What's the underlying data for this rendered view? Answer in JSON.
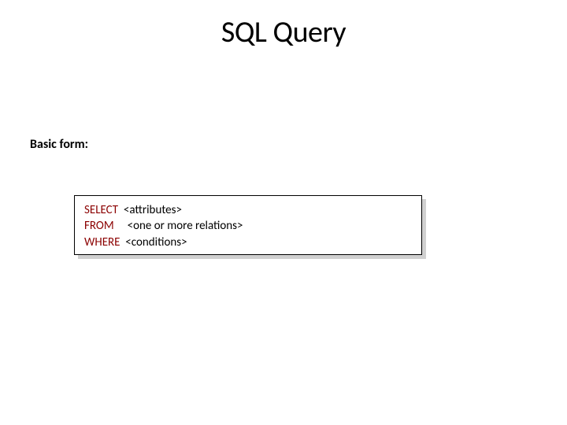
{
  "title": "SQL Query",
  "subtitle": "Basic form:",
  "code": {
    "kw_select": "SELECT",
    "arg_select": "<attributes>",
    "kw_from": "FROM",
    "arg_from": "<one or more relations>",
    "kw_where": "WHERE",
    "arg_where": "<conditions>"
  }
}
